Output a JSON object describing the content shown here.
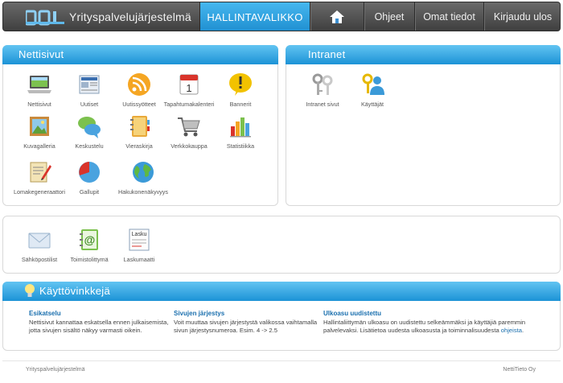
{
  "header": {
    "brand": "Yrityspalvelujärjestelmä",
    "nav_active": "HALLINTAVALIKKO",
    "nav_items": [
      "Ohjeet",
      "Omat tiedot",
      "Kirjaudu ulos"
    ]
  },
  "nettisivut": {
    "title": "Nettisivut",
    "tiles": [
      {
        "label": "Nettisivut",
        "icon": "laptop-icon"
      },
      {
        "label": "Uutiset",
        "icon": "newspaper-icon"
      },
      {
        "label": "Uutissyötteet",
        "icon": "rss-icon"
      },
      {
        "label": "Tapahtumakalenteri",
        "icon": "calendar-icon"
      },
      {
        "label": "Bannerit",
        "icon": "exclamation-bubble-icon"
      },
      {
        "label": "Kuvagalleria",
        "icon": "picture-icon"
      },
      {
        "label": "Keskustelu",
        "icon": "chat-bubbles-icon"
      },
      {
        "label": "Vieraskirja",
        "icon": "notebook-icon"
      },
      {
        "label": "Verkkokauppa",
        "icon": "shopping-cart-icon"
      },
      {
        "label": "Statistiikka",
        "icon": "bar-chart-icon"
      },
      {
        "label": "Lomakegeneraattori",
        "icon": "form-pencil-icon"
      },
      {
        "label": "Gallupit",
        "icon": "pie-chart-icon"
      },
      {
        "label": "Hakukonenäkyvyys",
        "icon": "globe-icon"
      }
    ]
  },
  "intranet": {
    "title": "Intranet",
    "tiles": [
      {
        "label": "Intranet sivut",
        "icon": "keys-icon"
      },
      {
        "label": "Käyttäjät",
        "icon": "user-key-icon"
      }
    ]
  },
  "extra": {
    "tiles": [
      {
        "label": "Sähköpostilist",
        "icon": "envelope-icon"
      },
      {
        "label": "Toimistolittymä",
        "icon": "address-book-icon"
      },
      {
        "label": "Laskumaatti",
        "icon": "invoice-icon",
        "icon_text": "Lasku"
      }
    ]
  },
  "tips": {
    "title": "Käyttövinkkejä",
    "items": [
      {
        "title": "Esikatselu",
        "text": "Nettisivut kannattaa eskatsella ennen julkaisemista, jotta sivujen sisältö näkyy varmasti oikein."
      },
      {
        "title": "Sivujen järjestys",
        "text": "Voit muuttaa sivujen järjestystä valikossa vaihtamalla sivun järjestysnumeroa. Esim. 4 -> 2.5"
      },
      {
        "title": "Ulkoasu uudistettu",
        "text": "Hallintaliittymän ulkoasu on uudistettu selkeämmäksi ja käyttäjiä paremmin palvelevaksi. Lisätietoa uudesta ulkoasusta ja toiminnalisuudesta ",
        "link": "ohjeista",
        "suffix": "."
      }
    ]
  },
  "footer": {
    "left": "Yrityspalvelujärjestelmä",
    "right": "NettiTieto Oy"
  }
}
